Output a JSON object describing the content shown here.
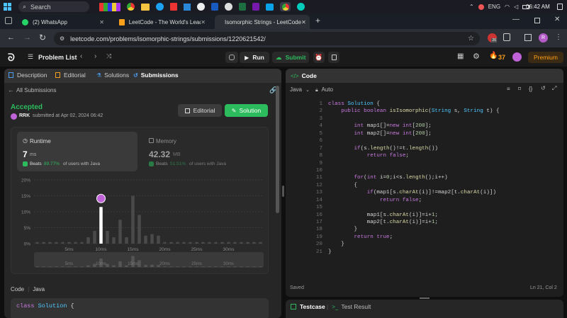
{
  "taskbar": {
    "search": "Search",
    "lang": "ENG",
    "time": "06:42 AM"
  },
  "browser_tabs": [
    {
      "label": "(2) WhatsApp"
    },
    {
      "label": "LeetCode - The World's Leading"
    },
    {
      "label": "Isomorphic Strings - LeetCode"
    }
  ],
  "address": {
    "url": "leetcode.com/problems/isomorphic-strings/submissions/1220621542/",
    "ext_badge": "26",
    "avatar": "R"
  },
  "lc_header": {
    "problem_list": "Problem List",
    "run": "Run",
    "submit": "Submit",
    "streak": "37",
    "premium": "Premium"
  },
  "left_tabs": [
    "Description",
    "Editorial",
    "Solutions",
    "Submissions"
  ],
  "all_submissions": "All Submissions",
  "result": {
    "status": "Accepted",
    "user": "RRK",
    "submitted": "submitted at Apr 02, 2024 06:42",
    "editorial_btn": "Editorial",
    "solution_btn": "Solution"
  },
  "runtime": {
    "label": "Runtime",
    "value": "7",
    "unit": "ms",
    "beats_prefix": "Beats",
    "beats_value": "89.77%",
    "beats_suffix": "of users with Java"
  },
  "memory": {
    "label": "Memory",
    "value": "42.32",
    "unit": "MB",
    "beats_prefix": "Beats",
    "beats_value": "51.51%",
    "beats_suffix": "of users with Java"
  },
  "chart_data": {
    "type": "bar",
    "yticks": [
      "20%",
      "15%",
      "10%",
      "5%",
      "0%"
    ],
    "xticks": [
      "5ms",
      "10ms",
      "15ms",
      "20ms",
      "25ms",
      "30ms"
    ],
    "ylim": [
      0,
      20
    ],
    "values": [
      0.5,
      0.5,
      0.5,
      0.5,
      0.5,
      0.5,
      0.5,
      0.5,
      2,
      4,
      11.5,
      4,
      2,
      7.5,
      2,
      15,
      9,
      2.5,
      3,
      2.5,
      0.5,
      0.5,
      0.5,
      0.5,
      0.5,
      0.5,
      0.5,
      0.5,
      0.5,
      0.5,
      0.5,
      0.5,
      0.5,
      0.5,
      0.5,
      0.5
    ],
    "highlight_index": 10,
    "mini_values": [
      0.3,
      0.3,
      0.3,
      0.3,
      0.3,
      0.3,
      0.3,
      0.3,
      0.9,
      1.8,
      4.8,
      1.8,
      0.9,
      3.2,
      0.9,
      6.2,
      3.8,
      1.1,
      1.3,
      1.1,
      0.3,
      0.3,
      0.3,
      0.3,
      0.3,
      0.3,
      0.3,
      0.3,
      0.3,
      0.3,
      0.3,
      0.3,
      0.3,
      0.3,
      0.3,
      0.3
    ]
  },
  "left_code": {
    "header": "Code",
    "lang": "Java",
    "line1a": "class",
    "line1b": "Solution",
    "line1c": "{"
  },
  "editor": {
    "title": "Code",
    "lang": "Java",
    "mode": "Auto",
    "saved": "Saved",
    "position": "Ln 21, Col 2",
    "lines": [
      [
        [
          "kw",
          "class "
        ],
        [
          "ty",
          "Solution "
        ],
        [
          "tx",
          "{"
        ]
      ],
      [
        [
          "tx",
          "    "
        ],
        [
          "kw",
          "public boolean "
        ],
        [
          "fn",
          "isIsomorphic"
        ],
        [
          "tx",
          "("
        ],
        [
          "ty",
          "String"
        ],
        [
          "tx",
          " s, "
        ],
        [
          "ty",
          "String"
        ],
        [
          "tx",
          " t) {"
        ]
      ],
      [
        [
          "tx",
          ""
        ]
      ],
      [
        [
          "tx",
          "        "
        ],
        [
          "kw",
          "int"
        ],
        [
          "tx",
          " map1[]="
        ],
        [
          "kw",
          "new int"
        ],
        [
          "tx",
          "["
        ],
        [
          "nm",
          "200"
        ],
        [
          "tx",
          "];"
        ]
      ],
      [
        [
          "tx",
          "        "
        ],
        [
          "kw",
          "int"
        ],
        [
          "tx",
          " map2[]="
        ],
        [
          "kw",
          "new int"
        ],
        [
          "tx",
          "["
        ],
        [
          "nm",
          "200"
        ],
        [
          "tx",
          "];"
        ]
      ],
      [
        [
          "tx",
          ""
        ]
      ],
      [
        [
          "tx",
          "        "
        ],
        [
          "kw",
          "if"
        ],
        [
          "tx",
          "(s."
        ],
        [
          "fn",
          "length"
        ],
        [
          "tx",
          "()!=t."
        ],
        [
          "fn",
          "length"
        ],
        [
          "tx",
          "())"
        ]
      ],
      [
        [
          "tx",
          "            "
        ],
        [
          "kw",
          "return false"
        ],
        [
          "tx",
          ";"
        ]
      ],
      [
        [
          "tx",
          ""
        ]
      ],
      [
        [
          "tx",
          ""
        ]
      ],
      [
        [
          "tx",
          "        "
        ],
        [
          "kw",
          "for"
        ],
        [
          "tx",
          "("
        ],
        [
          "kw",
          "int"
        ],
        [
          "tx",
          " i="
        ],
        [
          "nm",
          "0"
        ],
        [
          "tx",
          ";i<s."
        ],
        [
          "fn",
          "length"
        ],
        [
          "tx",
          "();i++)"
        ]
      ],
      [
        [
          "tx",
          "        {"
        ]
      ],
      [
        [
          "tx",
          "            "
        ],
        [
          "kw",
          "if"
        ],
        [
          "tx",
          "(map1[s."
        ],
        [
          "fn",
          "charAt"
        ],
        [
          "tx",
          "(i)]!=map2[t."
        ],
        [
          "fn",
          "charAt"
        ],
        [
          "tx",
          "(i)])"
        ]
      ],
      [
        [
          "tx",
          "                "
        ],
        [
          "kw",
          "return false"
        ],
        [
          "tx",
          ";"
        ]
      ],
      [
        [
          "tx",
          ""
        ]
      ],
      [
        [
          "tx",
          "            map1[s."
        ],
        [
          "fn",
          "charAt"
        ],
        [
          "tx",
          "(i)]=i+"
        ],
        [
          "nm",
          "1"
        ],
        [
          "tx",
          ";"
        ]
      ],
      [
        [
          "tx",
          "            map2[t."
        ],
        [
          "fn",
          "charAt"
        ],
        [
          "tx",
          "(i)]=i+"
        ],
        [
          "nm",
          "1"
        ],
        [
          "tx",
          ";"
        ]
      ],
      [
        [
          "tx",
          "        }"
        ]
      ],
      [
        [
          "tx",
          "        "
        ],
        [
          "kw",
          "return true"
        ],
        [
          "tx",
          ";"
        ]
      ],
      [
        [
          "tx",
          "    }"
        ]
      ],
      [
        [
          "tx",
          "}"
        ]
      ]
    ]
  },
  "bottom_tabs": {
    "testcase": "Testcase",
    "test_result": "Test Result"
  }
}
